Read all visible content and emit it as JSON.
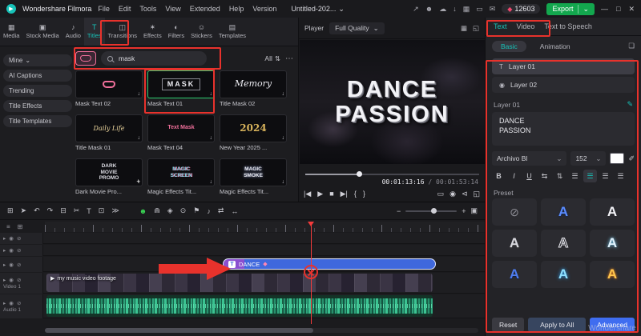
{
  "colors": {
    "accent": "#17c2b8",
    "export_green": "#13a74e",
    "annotation_red": "#e8322c",
    "clip_blue": "#3f68dd",
    "waveform_green": "#35b285",
    "selection_green": "#2ecc71",
    "advanced_blue": "#3f6df0",
    "playhead_red": "#f43b3b"
  },
  "menubar": {
    "logo_glyph": "▶",
    "brand": "Wondershare Filmora",
    "menus": [
      {
        "label": "File"
      },
      {
        "label": "Edit"
      },
      {
        "label": "Tools"
      },
      {
        "label": "View"
      },
      {
        "label": "Extended"
      },
      {
        "label": "Help"
      },
      {
        "label": "Version"
      }
    ],
    "project_title": "Untitled-202...",
    "title_chevron": "⌄",
    "icons": [
      {
        "name": "share-icon",
        "glyph": "↗"
      },
      {
        "name": "user-icon",
        "glyph": "☻"
      },
      {
        "name": "cloud-icon",
        "glyph": "☁"
      },
      {
        "name": "download-icon",
        "glyph": "↓"
      },
      {
        "name": "layout-icon",
        "glyph": "▦"
      },
      {
        "name": "display-icon",
        "glyph": "▭"
      },
      {
        "name": "notification-icon",
        "glyph": "✉"
      }
    ],
    "gem_glyph": "◆",
    "points": "12603",
    "export_label": "Export",
    "export_chevron": "⌄",
    "window": [
      {
        "name": "minimize-button",
        "glyph": "—"
      },
      {
        "name": "maximize-button",
        "glyph": "□"
      },
      {
        "name": "close-button",
        "glyph": "✕"
      }
    ]
  },
  "media_tabs": [
    {
      "label": "Media",
      "glyph": "▦"
    },
    {
      "label": "Stock Media",
      "glyph": "▣"
    },
    {
      "label": "Audio",
      "glyph": "♪"
    },
    {
      "label": "Titles",
      "glyph": "T",
      "active": true
    },
    {
      "label": "Transitions",
      "glyph": "◫"
    },
    {
      "label": "Effects",
      "glyph": "✶"
    },
    {
      "label": "Filters",
      "glyph": "◐"
    },
    {
      "label": "Stickers",
      "glyph": "☺"
    },
    {
      "label": "Templates",
      "glyph": "▤"
    }
  ],
  "sidebar": [
    {
      "label": "Mine",
      "chevron": "⌄"
    },
    {
      "label": "AI Captions"
    },
    {
      "label": "Trending"
    },
    {
      "label": "Title Effects"
    },
    {
      "label": "Title Templates"
    }
  ],
  "search": {
    "value": "mask",
    "filter_label": "All",
    "filter_glyph": "⇅",
    "more_glyph": "⋯"
  },
  "template_download_glyph": "↓",
  "templates": [
    {
      "name": "Mask Text 02",
      "style": "mask-pink",
      "thumb_text": ""
    },
    {
      "name": "Mask Text 01",
      "style": "mask-word",
      "thumb_text": "MASK",
      "selected": true
    },
    {
      "name": "Title Mask 02",
      "style": "memory",
      "thumb_text": "Memory"
    },
    {
      "name": "Title Mask 01",
      "style": "daily",
      "thumb_text": "Daily Life"
    },
    {
      "name": "Mask Text 04",
      "style": "pink-small",
      "thumb_text": "Text Mask"
    },
    {
      "name": "New Year 2025 ...",
      "style": "gold",
      "thumb_text": "2024"
    },
    {
      "name": "Dark Movie Pro...",
      "style": "dark-movie",
      "thumb_text": "DARK\nMOVIE\nPROMO",
      "badge": "+"
    },
    {
      "name": "Magic Effects Tit...",
      "style": "magic-screen",
      "thumb_text": "MAGIC\nSCREEN"
    },
    {
      "name": "Magic Effects Tit...",
      "style": "magic-smoke",
      "thumb_text": "MAGIC\nSMOKE"
    }
  ],
  "player": {
    "label": "Player",
    "quality": "Full Quality",
    "quality_chevron": "⌄",
    "header_icons": [
      {
        "name": "multi-view-icon",
        "glyph": "▦"
      },
      {
        "name": "enlarge-preview-icon",
        "glyph": "◱"
      }
    ],
    "preview_title": "DANCE\nPASSION",
    "progress_pct": 31,
    "time_current": "00:01:13:16",
    "time_sep": " / ",
    "time_total": "00:01:53:14",
    "transport": [
      {
        "name": "prev-frame-button",
        "glyph": "|◀"
      },
      {
        "name": "play-button",
        "glyph": "▶"
      },
      {
        "name": "stop-button",
        "glyph": "■"
      },
      {
        "name": "next-frame-button",
        "glyph": "▶|"
      },
      {
        "name": "mark-in-button",
        "glyph": "{"
      },
      {
        "name": "mark-out-button",
        "glyph": "}"
      }
    ],
    "transport_right": [
      {
        "name": "display-device-button",
        "glyph": "▭"
      },
      {
        "name": "snapshot-button",
        "glyph": "◉"
      },
      {
        "name": "volume-button",
        "glyph": "⊲"
      },
      {
        "name": "fullscreen-button",
        "glyph": "◱"
      }
    ]
  },
  "right_panel": {
    "tabs": [
      {
        "label": "Text",
        "active": true
      },
      {
        "label": "Video"
      },
      {
        "label": "Text to Speech"
      }
    ],
    "subtabs": [
      {
        "label": "Basic",
        "active": true
      },
      {
        "label": "Animation"
      }
    ],
    "bookmark_glyph": "❏",
    "layers": [
      {
        "glyph": "T",
        "label": "Layer 01",
        "active": true
      },
      {
        "glyph": "◉",
        "label": "Layer 02"
      }
    ],
    "layer_header": "Layer 01",
    "edit_glyph": "✎",
    "text_value": "DANCE\nPASSION",
    "font_family": "Archivo Bl",
    "font_chevron": "⌄",
    "font_size": "152",
    "dropper_glyph": "✐",
    "format": [
      {
        "name": "bold-button",
        "glyph": "B",
        "style": "bold"
      },
      {
        "name": "italic-button",
        "glyph": "I",
        "style": "italic"
      },
      {
        "name": "underline-button",
        "glyph": "U",
        "style": "underline"
      },
      {
        "name": "letter-spacing-button",
        "glyph": "⇆"
      },
      {
        "name": "line-spacing-button",
        "glyph": "⇅"
      },
      {
        "name": "align-left-button",
        "glyph": "☰"
      },
      {
        "name": "align-center-button",
        "glyph": "☰",
        "active": true
      },
      {
        "name": "align-right-button",
        "glyph": "☰"
      },
      {
        "name": "align-justify-button",
        "glyph": "☰"
      }
    ],
    "preset_label": "Preset",
    "presets": [
      {
        "style": "none",
        "glyph": "⊘"
      },
      {
        "style": "blue",
        "glyph": "A"
      },
      {
        "style": "white",
        "glyph": "A"
      },
      {
        "style": "silver",
        "glyph": "A"
      },
      {
        "style": "outline",
        "glyph": "A"
      },
      {
        "style": "glow",
        "glyph": "A"
      },
      {
        "style": "royal",
        "glyph": "A"
      },
      {
        "style": "neon",
        "glyph": "A"
      },
      {
        "style": "amber",
        "glyph": "A"
      },
      {
        "style": "sky",
        "glyph": "A"
      },
      {
        "style": "orange",
        "glyph": "A"
      },
      {
        "style": "darkp",
        "glyph": "A"
      }
    ],
    "footer": {
      "reset": "Reset",
      "apply": "Apply to All",
      "advanced": "Advanced"
    }
  },
  "timeline": {
    "toolbar_left": [
      {
        "name": "media-board-icon",
        "glyph": "⊞"
      },
      {
        "name": "pointer-tool-icon",
        "glyph": "➤"
      },
      {
        "name": "undo-icon",
        "glyph": "↶"
      },
      {
        "name": "redo-icon",
        "glyph": "↷"
      },
      {
        "name": "delete-icon",
        "glyph": "⊟"
      },
      {
        "name": "split-icon",
        "glyph": "✂"
      },
      {
        "name": "text-tool-icon",
        "glyph": "T"
      },
      {
        "name": "crop-icon",
        "glyph": "⊡"
      },
      {
        "name": "more-tools-icon",
        "glyph": "≫"
      }
    ],
    "toolbar_center": [
      {
        "name": "ai-portrait-icon",
        "glyph": "☻",
        "style": "ai"
      },
      {
        "name": "magnet-snap-icon",
        "glyph": "⋒"
      },
      {
        "name": "keyframe-icon",
        "glyph": "◈"
      },
      {
        "name": "record-icon",
        "glyph": "⊙"
      },
      {
        "name": "marker-icon",
        "glyph": "⚑"
      },
      {
        "name": "voiceover-icon",
        "glyph": "♪"
      },
      {
        "name": "render-preview-icon",
        "glyph": "⇄"
      },
      {
        "name": "auto-ripple-icon",
        "glyph": "↔"
      }
    ],
    "zoom_out_glyph": "−",
    "zoom_in_glyph": "+",
    "fit_glyph": "▣",
    "header_icons": [
      {
        "name": "manage-tracks-icon",
        "glyph": "≡"
      },
      {
        "name": "add-track-icon",
        "glyph": "⊞"
      }
    ],
    "track_icons": [
      {
        "glyph": "▸"
      },
      {
        "glyph": "◉"
      },
      {
        "glyph": "⊘"
      }
    ],
    "clip": {
      "icon": "T",
      "label": "DANCE",
      "badge_glyph": "◆"
    },
    "video_track": {
      "name": "Video 1",
      "clip_icon": "▶",
      "clip_label": "my music video footage"
    },
    "audio_track": {
      "name": "Audio 1"
    }
  },
  "watermark": "Wondershare"
}
